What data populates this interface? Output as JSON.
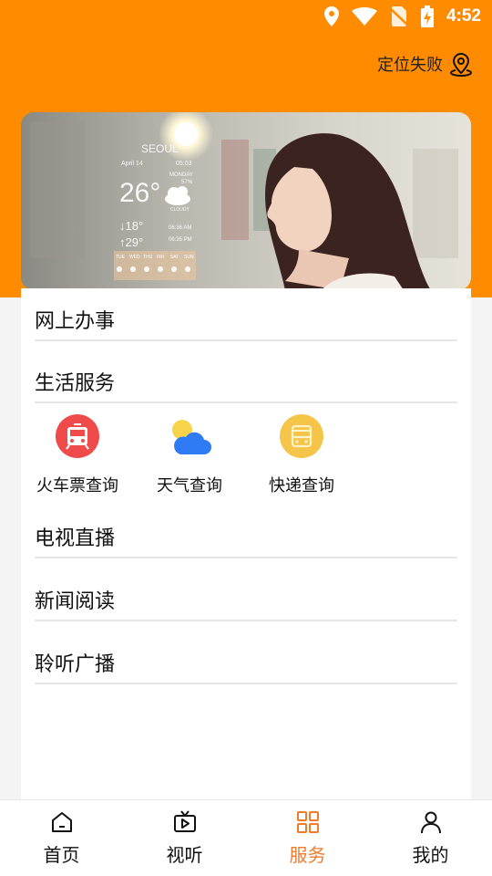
{
  "status_bar": {
    "time": "4:52",
    "icons": [
      "location-icon",
      "wifi-icon",
      "no-sim-icon",
      "battery-charging-icon"
    ]
  },
  "header": {
    "location_text": "定位失败",
    "location_icon": "location-pin-icon",
    "background_color": "#ff8c00"
  },
  "banner": {
    "weather": {
      "city": "SEOUL",
      "date": "April 14",
      "time": "05:03",
      "day": "MONDAY",
      "humidity": "57%",
      "temperature": "26°",
      "condition": "CLOUDY",
      "low": "↓18°",
      "high": "↑29°",
      "sunrise": "06:36 AM",
      "sunset": "06:35 PM",
      "forecast_days": [
        "TUE",
        "WED",
        "THU",
        "FRI",
        "SAT",
        "SUN"
      ]
    }
  },
  "sections": {
    "online_affairs": "网上办事",
    "life_services": "生活服务",
    "tv_live": "电视直播",
    "news_reading": "新闻阅读",
    "radio": "聆听广播"
  },
  "services": [
    {
      "label": "火车票查询",
      "icon": "train-icon",
      "color": "#ef4b4b"
    },
    {
      "label": "天气查询",
      "icon": "weather-icon",
      "color": "#2f7af5"
    },
    {
      "label": "快递查询",
      "icon": "bus-icon",
      "color": "#f5c54a"
    }
  ],
  "tabbar": {
    "tabs": [
      {
        "label": "首页",
        "icon": "home-icon"
      },
      {
        "label": "视听",
        "icon": "tv-icon"
      },
      {
        "label": "服务",
        "icon": "grid-icon"
      },
      {
        "label": "我的",
        "icon": "user-icon"
      }
    ],
    "active_tab": "服务",
    "active_color": "#f07c2b"
  }
}
